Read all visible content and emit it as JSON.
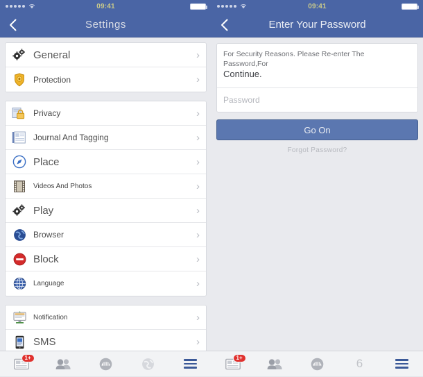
{
  "status_bar": {
    "signal_dots": 5,
    "wifi_icon": "wifi-icon",
    "time": "09:41",
    "battery_icon": "battery-icon"
  },
  "left_screen": {
    "nav": {
      "back_icon": "chevron-left-icon",
      "title": "Settings"
    },
    "groups": [
      {
        "rows": [
          {
            "icon": "gears-icon",
            "label": "General",
            "size": "big",
            "chevron": "›"
          },
          {
            "icon": "shield-badge-icon",
            "label": "Protection",
            "size": "mid",
            "chevron": "›"
          }
        ]
      },
      {
        "rows": [
          {
            "icon": "lock-privacy-icon",
            "label": "Privacy",
            "size": "mid",
            "chevron": "›"
          },
          {
            "icon": "journal-icon",
            "label": "Journal And Tagging",
            "size": "mid",
            "chevron": "›"
          },
          {
            "icon": "compass-place-icon",
            "label": "Place",
            "size": "big",
            "chevron": "›"
          },
          {
            "icon": "film-strip-icon",
            "label": "Videos And Photos",
            "size": "small",
            "chevron": "›"
          },
          {
            "icon": "gears-icon",
            "label": "Play",
            "size": "big",
            "chevron": "›"
          },
          {
            "icon": "globe-browser-icon",
            "label": "Browser",
            "size": "mid",
            "chevron": "›"
          },
          {
            "icon": "block-icon",
            "label": "Block",
            "size": "big",
            "chevron": "›"
          },
          {
            "icon": "globe-language-icon",
            "label": "Language",
            "size": "small",
            "chevron": "›"
          }
        ]
      },
      {
        "rows": [
          {
            "icon": "monitor-notification-icon",
            "label": "Notification",
            "size": "small",
            "chevron": "›"
          },
          {
            "icon": "phone-sms-icon",
            "label": "SMS",
            "size": "big",
            "chevron": "›"
          }
        ]
      }
    ]
  },
  "right_screen": {
    "nav": {
      "back_icon": "chevron-left-icon",
      "title": "Enter Your Password"
    },
    "message_line1": "For Security Reasons. Please Re-enter The Password,For",
    "message_line2": "Continue.",
    "password_placeholder": "Password",
    "password_value": "",
    "go_button_label": "Go On",
    "forgot_label": "Forgot Password?"
  },
  "tab_bar_left": {
    "tabs": [
      {
        "icon": "news-feed-icon",
        "badge": "1+"
      },
      {
        "icon": "friends-icon",
        "badge": ""
      },
      {
        "icon": "messenger-icon",
        "badge": ""
      },
      {
        "icon": "globe-notifications-icon",
        "badge": ""
      },
      {
        "icon": "hamburger-menu-icon",
        "badge": ""
      }
    ]
  },
  "tab_bar_right": {
    "tabs": [
      {
        "icon": "news-feed-icon",
        "badge": "1+"
      },
      {
        "icon": "friends-icon",
        "badge": ""
      },
      {
        "icon": "messenger-icon",
        "badge": ""
      },
      {
        "icon": "notification-count-icon",
        "badge": "",
        "number": "6"
      },
      {
        "icon": "hamburger-menu-icon",
        "badge": ""
      }
    ]
  },
  "colors": {
    "nav_blue": "#4a65a5",
    "page_bg": "#e9eaee",
    "button_blue": "#5b77b0",
    "badge_red": "#e0312e",
    "status_time": "#c9c98a",
    "brand_blue": "#3b5998"
  }
}
